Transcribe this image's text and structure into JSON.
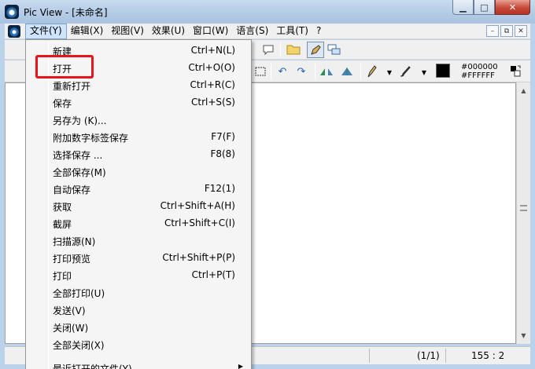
{
  "window": {
    "title": "Pic View - [未命名]",
    "controls": {
      "minimize": "▁",
      "maximize": "□",
      "close": "✕"
    }
  },
  "menubar": {
    "items": [
      {
        "label": "文件(Y)",
        "active": true
      },
      {
        "label": "编辑(X)"
      },
      {
        "label": "视图(V)"
      },
      {
        "label": "效果(U)"
      },
      {
        "label": "窗口(W)"
      },
      {
        "label": "语言(S)"
      },
      {
        "label": "工具(T)"
      },
      {
        "label": "?"
      }
    ],
    "mdi": {
      "minimize": "–",
      "restore": "⧉",
      "close": "✕"
    }
  },
  "toolbar": {
    "color_primary": "#000000",
    "color_secondary": "#FFFFFF",
    "icons": [
      "folder-icon",
      "pencil-icon",
      "window-icon",
      "select-rect-icon",
      "undo-icon",
      "redo-icon",
      "flip-icon",
      "rotate-icon",
      "pen-icon",
      "brush-icon",
      "swap-colors-icon"
    ]
  },
  "file_menu": {
    "items": [
      {
        "label": "新建",
        "shortcut": "Ctrl+N(L)"
      },
      {
        "label": "打开",
        "shortcut": "Ctrl+O(O)",
        "highlighted": true
      },
      {
        "label": "重新打开",
        "shortcut": "Ctrl+R(C)"
      },
      {
        "label": "保存",
        "shortcut": "Ctrl+S(S)"
      },
      {
        "label": "另存为 (K)...",
        "shortcut": ""
      },
      {
        "label": "附加数字标签保存",
        "shortcut": "F7(F)"
      },
      {
        "label": "选择保存 ...",
        "shortcut": "F8(8)"
      },
      {
        "label": "全部保存(M)",
        "shortcut": ""
      },
      {
        "label": "自动保存",
        "shortcut": "F12(1)"
      },
      {
        "label": "获取",
        "shortcut": "Ctrl+Shift+A(H)"
      },
      {
        "label": "截屏",
        "shortcut": "Ctrl+Shift+C(I)"
      },
      {
        "label": "扫描源(N)",
        "shortcut": ""
      },
      {
        "label": "打印预览",
        "shortcut": "Ctrl+Shift+P(P)"
      },
      {
        "label": "打印",
        "shortcut": "Ctrl+P(T)"
      },
      {
        "label": "全部打印(U)",
        "shortcut": ""
      },
      {
        "label": "发送(V)",
        "shortcut": ""
      },
      {
        "label": "关闭(W)",
        "shortcut": ""
      },
      {
        "label": "全部关闭(X)",
        "shortcut": ""
      },
      {
        "label": "最近打开的文件(Y)",
        "shortcut": "",
        "submenu": "▶"
      }
    ]
  },
  "statusbar": {
    "page": "(1/1)",
    "ratio": "155 : 2"
  }
}
